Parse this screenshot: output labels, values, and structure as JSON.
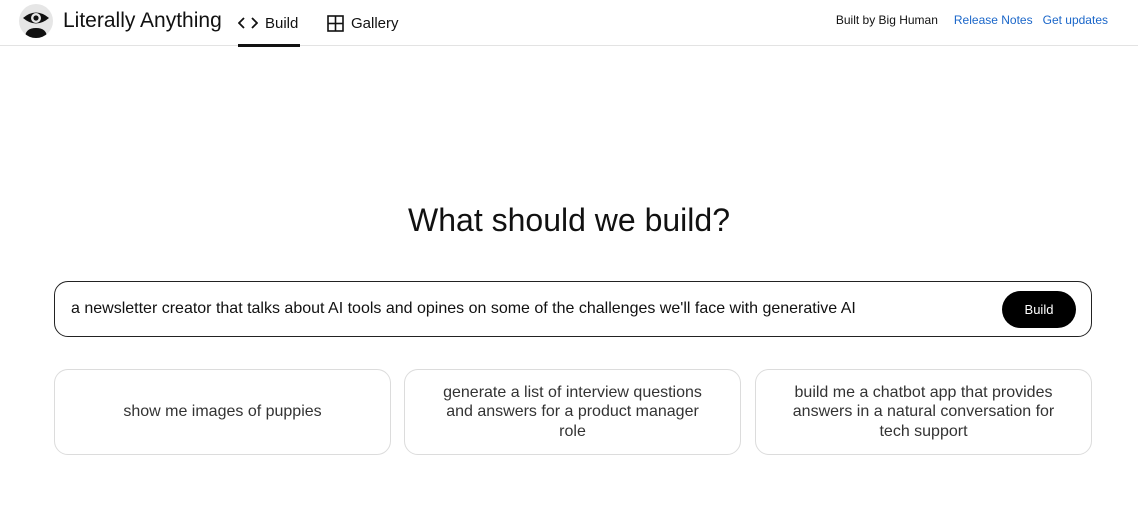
{
  "header": {
    "app_title": "Literally Anything",
    "tabs": [
      {
        "label": "Build",
        "icon": "code-brackets-icon",
        "active": true
      },
      {
        "label": "Gallery",
        "icon": "grid-icon",
        "active": false
      }
    ],
    "built_by": "Built by Big Human",
    "links": [
      "Release Notes",
      "Get updates"
    ]
  },
  "main": {
    "headline": "What should we build?",
    "prompt": {
      "value": "a newsletter creator that talks about AI tools and opines on some of the challenges we'll face with generative AI",
      "button_label": "Build"
    },
    "suggestions": [
      "show me images of puppies",
      "generate a list of interview questions and answers for a product manager role",
      "build me a chatbot app that provides answers in a natural conversation for tech support"
    ]
  },
  "colors": {
    "accent_link": "#1a66c9",
    "button_bg": "#000000",
    "border": "#dcdcdc"
  }
}
